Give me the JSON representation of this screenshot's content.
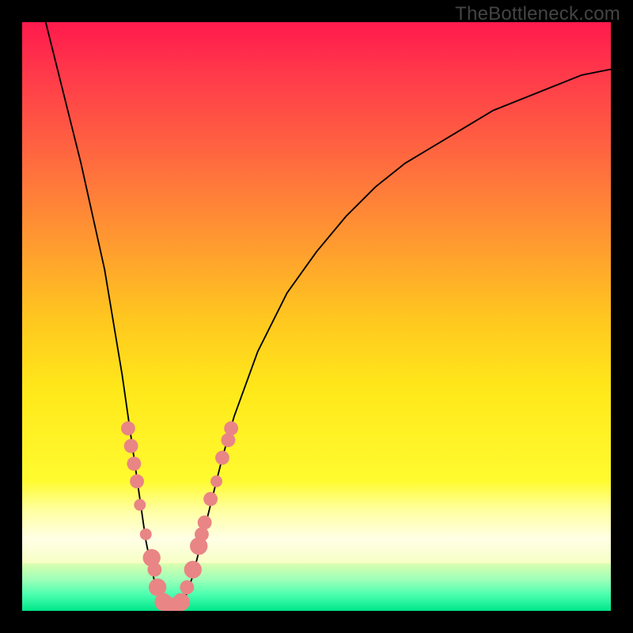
{
  "watermark": "TheBottleneck.com",
  "chart_data": {
    "type": "line",
    "title": "",
    "xlabel": "",
    "ylabel": "",
    "xlim": [
      0,
      100
    ],
    "ylim": [
      0,
      100
    ],
    "grid": false,
    "legend": false,
    "curve_points": [
      {
        "x": 4,
        "y": 100
      },
      {
        "x": 6,
        "y": 92
      },
      {
        "x": 8,
        "y": 84
      },
      {
        "x": 10,
        "y": 76
      },
      {
        "x": 12,
        "y": 67
      },
      {
        "x": 14,
        "y": 58
      },
      {
        "x": 15,
        "y": 52
      },
      {
        "x": 16,
        "y": 46
      },
      {
        "x": 17,
        "y": 40
      },
      {
        "x": 18,
        "y": 33
      },
      {
        "x": 19,
        "y": 26
      },
      {
        "x": 20,
        "y": 19
      },
      {
        "x": 21,
        "y": 12
      },
      {
        "x": 22,
        "y": 7
      },
      {
        "x": 23,
        "y": 3
      },
      {
        "x": 24,
        "y": 1
      },
      {
        "x": 25,
        "y": 0
      },
      {
        "x": 26,
        "y": 0
      },
      {
        "x": 27,
        "y": 1
      },
      {
        "x": 28,
        "y": 3
      },
      {
        "x": 29,
        "y": 6
      },
      {
        "x": 30,
        "y": 10
      },
      {
        "x": 32,
        "y": 18
      },
      {
        "x": 34,
        "y": 26
      },
      {
        "x": 36,
        "y": 33
      },
      {
        "x": 40,
        "y": 44
      },
      {
        "x": 45,
        "y": 54
      },
      {
        "x": 50,
        "y": 61
      },
      {
        "x": 55,
        "y": 67
      },
      {
        "x": 60,
        "y": 72
      },
      {
        "x": 65,
        "y": 76
      },
      {
        "x": 70,
        "y": 79
      },
      {
        "x": 75,
        "y": 82
      },
      {
        "x": 80,
        "y": 85
      },
      {
        "x": 85,
        "y": 87
      },
      {
        "x": 90,
        "y": 89
      },
      {
        "x": 95,
        "y": 91
      },
      {
        "x": 100,
        "y": 92
      }
    ],
    "scatter_points": [
      {
        "x": 18,
        "y": 31,
        "r": 1.2
      },
      {
        "x": 18.5,
        "y": 28,
        "r": 1.2
      },
      {
        "x": 19,
        "y": 25,
        "r": 1.2
      },
      {
        "x": 19.5,
        "y": 22,
        "r": 1.2
      },
      {
        "x": 20,
        "y": 18,
        "r": 1.0
      },
      {
        "x": 21,
        "y": 13,
        "r": 1.0
      },
      {
        "x": 22,
        "y": 9,
        "r": 1.5
      },
      {
        "x": 22.5,
        "y": 7,
        "r": 1.2
      },
      {
        "x": 23,
        "y": 4,
        "r": 1.5
      },
      {
        "x": 24,
        "y": 1.5,
        "r": 1.5
      },
      {
        "x": 25,
        "y": 0.8,
        "r": 1.5
      },
      {
        "x": 26,
        "y": 0.8,
        "r": 1.5
      },
      {
        "x": 27,
        "y": 1.5,
        "r": 1.5
      },
      {
        "x": 28,
        "y": 4,
        "r": 1.2
      },
      {
        "x": 29,
        "y": 7,
        "r": 1.5
      },
      {
        "x": 30,
        "y": 11,
        "r": 1.5
      },
      {
        "x": 30.5,
        "y": 13,
        "r": 1.2
      },
      {
        "x": 31,
        "y": 15,
        "r": 1.2
      },
      {
        "x": 32,
        "y": 19,
        "r": 1.2
      },
      {
        "x": 33,
        "y": 22,
        "r": 1.0
      },
      {
        "x": 34,
        "y": 26,
        "r": 1.2
      },
      {
        "x": 35,
        "y": 29,
        "r": 1.2
      },
      {
        "x": 35.5,
        "y": 31,
        "r": 1.2
      }
    ],
    "gradient_bands": [
      {
        "name": "red-yellow",
        "from_y": 22,
        "to_y": 100
      },
      {
        "name": "pale-yellow",
        "from_y": 8,
        "to_y": 22
      },
      {
        "name": "green",
        "from_y": 0,
        "to_y": 8
      }
    ]
  }
}
